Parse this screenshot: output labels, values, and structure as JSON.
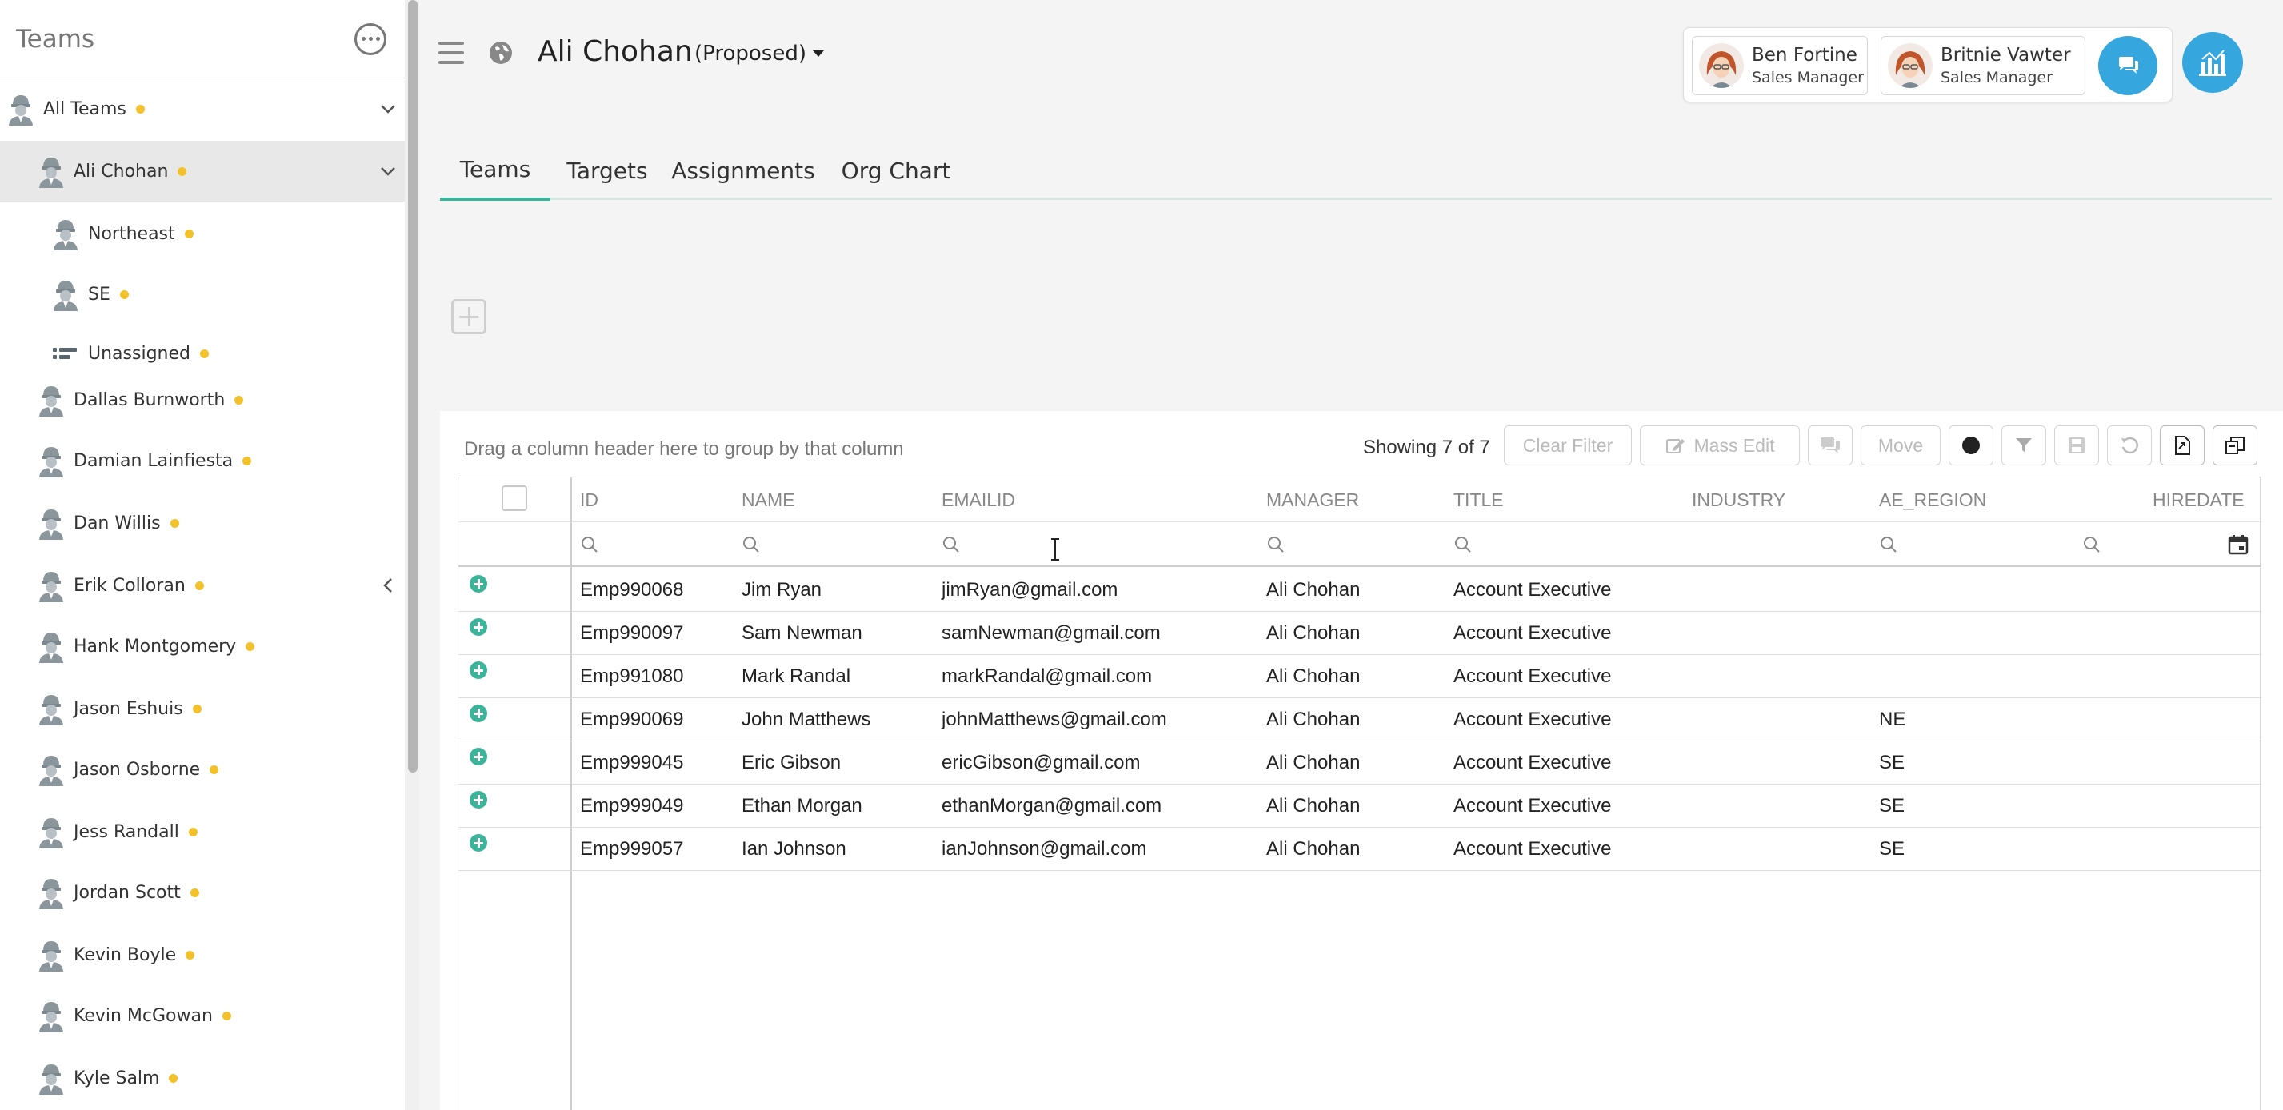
{
  "sidebar": {
    "title": "Teams",
    "items": [
      {
        "label": "All Teams",
        "indent": 0,
        "icon": "person-icon",
        "chevron": "down",
        "selected": false
      },
      {
        "label": "Ali Chohan",
        "indent": 1,
        "icon": "person-icon",
        "chevron": "down",
        "selected": true
      },
      {
        "label": "Northeast",
        "indent": 2,
        "icon": "person-icon",
        "chevron": "",
        "selected": false
      },
      {
        "label": "SE",
        "indent": 2,
        "icon": "person-icon",
        "chevron": "",
        "selected": false
      },
      {
        "label": "Unassigned",
        "indent": 2,
        "icon": "list-icon",
        "chevron": "",
        "selected": false
      },
      {
        "label": "Dallas Burnworth",
        "indent": 1,
        "icon": "person-icon",
        "chevron": "",
        "selected": false
      },
      {
        "label": "Damian Lainfiesta",
        "indent": 1,
        "icon": "person-icon",
        "chevron": "",
        "selected": false
      },
      {
        "label": "Dan Willis",
        "indent": 1,
        "icon": "person-icon",
        "chevron": "",
        "selected": false
      },
      {
        "label": "Erik Colloran",
        "indent": 1,
        "icon": "person-icon",
        "chevron": "left",
        "selected": false
      },
      {
        "label": "Hank Montgomery",
        "indent": 1,
        "icon": "person-icon",
        "chevron": "",
        "selected": false
      },
      {
        "label": "Jason Eshuis",
        "indent": 1,
        "icon": "person-icon",
        "chevron": "",
        "selected": false
      },
      {
        "label": "Jason Osborne",
        "indent": 1,
        "icon": "person-icon",
        "chevron": "",
        "selected": false
      },
      {
        "label": "Jess Randall",
        "indent": 1,
        "icon": "person-icon",
        "chevron": "",
        "selected": false
      },
      {
        "label": "Jordan Scott",
        "indent": 1,
        "icon": "person-icon",
        "chevron": "",
        "selected": false
      },
      {
        "label": "Kevin Boyle",
        "indent": 1,
        "icon": "person-icon",
        "chevron": "",
        "selected": false
      },
      {
        "label": "Kevin McGowan",
        "indent": 1,
        "icon": "person-icon",
        "chevron": "",
        "selected": false
      },
      {
        "label": "Kyle Salm",
        "indent": 1,
        "icon": "person-icon",
        "chevron": "",
        "selected": false
      }
    ]
  },
  "header": {
    "title": "Ali Chohan",
    "scenario": "(Proposed)",
    "people": [
      {
        "name": "Ben Fortine",
        "role": "Sales Manager"
      },
      {
        "name": "Britnie Vawter",
        "role": "Sales Manager"
      }
    ]
  },
  "tabs": [
    {
      "label": "Teams",
      "active": true
    },
    {
      "label": "Targets",
      "active": false
    },
    {
      "label": "Assignments",
      "active": false
    },
    {
      "label": "Org Chart",
      "active": false
    }
  ],
  "grid": {
    "drag_hint": "Drag a column header here to group by that column",
    "showing": "Showing 7 of 7",
    "clear_filter": "Clear Filter",
    "mass_edit": "Mass Edit",
    "move": "Move",
    "columns": [
      "ID",
      "NAME",
      "EMAILID",
      "MANAGER",
      "TITLE",
      "INDUSTRY",
      "AE_REGION",
      "HIREDATE"
    ],
    "rows": [
      {
        "id": "Emp990068",
        "name": "Jim Ryan",
        "email": "jimRyan@gmail.com",
        "manager": "Ali Chohan",
        "title": "Account Executive",
        "industry": "",
        "region": ""
      },
      {
        "id": "Emp990097",
        "name": "Sam Newman",
        "email": "samNewman@gmail.com",
        "manager": "Ali Chohan",
        "title": "Account Executive",
        "industry": "",
        "region": ""
      },
      {
        "id": "Emp991080",
        "name": "Mark Randal",
        "email": "markRandal@gmail.com",
        "manager": "Ali Chohan",
        "title": "Account Executive",
        "industry": "",
        "region": ""
      },
      {
        "id": "Emp990069",
        "name": "John Matthews",
        "email": "johnMatthews@gmail.com",
        "manager": "Ali Chohan",
        "title": "Account Executive",
        "industry": "",
        "region": "NE"
      },
      {
        "id": "Emp999045",
        "name": "Eric Gibson",
        "email": "ericGibson@gmail.com",
        "manager": "Ali Chohan",
        "title": "Account Executive",
        "industry": "",
        "region": "SE"
      },
      {
        "id": "Emp999049",
        "name": "Ethan Morgan",
        "email": "ethanMorgan@gmail.com",
        "manager": "Ali Chohan",
        "title": "Account Executive",
        "industry": "",
        "region": "SE"
      },
      {
        "id": "Emp999057",
        "name": "Ian Johnson",
        "email": "ianJohnson@gmail.com",
        "manager": "Ali Chohan",
        "title": "Account Executive",
        "industry": "",
        "region": "SE"
      }
    ]
  },
  "colors": {
    "accent": "#3ab59a",
    "action_blue": "#35a7de",
    "status_dot": "#f3c12a"
  }
}
